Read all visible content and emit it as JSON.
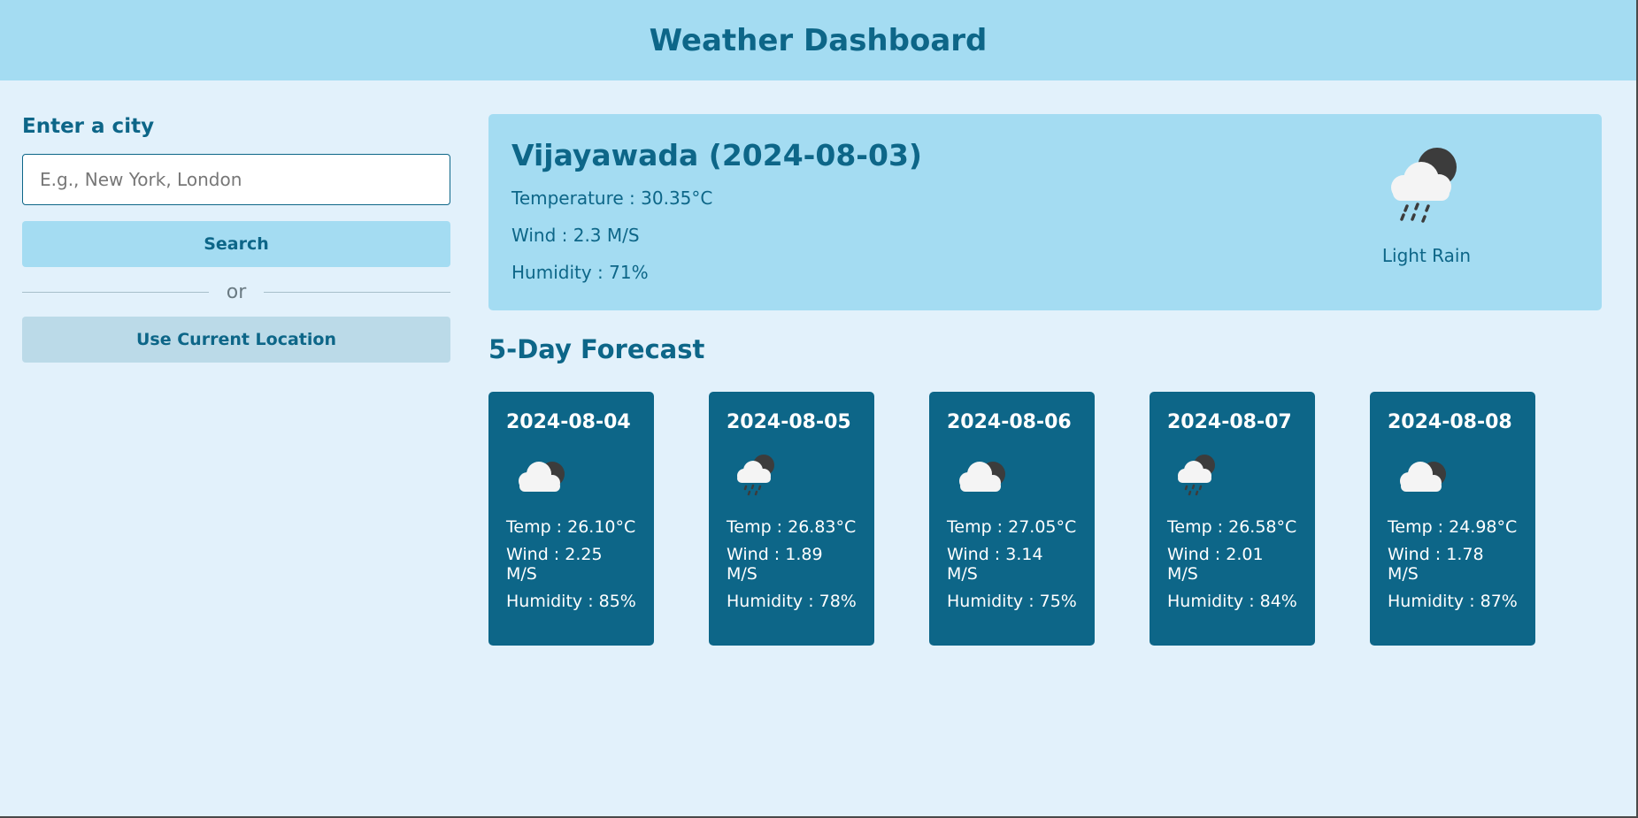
{
  "header": {
    "title": "Weather Dashboard"
  },
  "sidebar": {
    "label": "Enter a city",
    "input_placeholder": "E.g., New York, London",
    "input_value": "",
    "search_label": "Search",
    "or_text": "or",
    "location_label": "Use Current Location"
  },
  "current": {
    "heading": "Vijayawada (2024-08-03)",
    "temperature": "Temperature : 30.35°C",
    "wind": "Wind : 2.3 M/S",
    "humidity": "Humidity : 71%",
    "description": "Light Rain",
    "icon": "cloud-rain-moon-icon"
  },
  "forecast": {
    "title": "5-Day Forecast",
    "days": [
      {
        "date": "2024-08-04",
        "icon": "cloud-moon-icon",
        "temp": "Temp : 26.10°C",
        "wind": "Wind : 2.25 M/S",
        "humidity": "Humidity : 85%"
      },
      {
        "date": "2024-08-05",
        "icon": "cloud-rain-moon-icon",
        "temp": "Temp : 26.83°C",
        "wind": "Wind : 1.89 M/S",
        "humidity": "Humidity : 78%"
      },
      {
        "date": "2024-08-06",
        "icon": "cloud-moon-icon",
        "temp": "Temp : 27.05°C",
        "wind": "Wind : 3.14 M/S",
        "humidity": "Humidity : 75%"
      },
      {
        "date": "2024-08-07",
        "icon": "cloud-rain-moon-icon",
        "temp": "Temp : 26.58°C",
        "wind": "Wind : 2.01 M/S",
        "humidity": "Humidity : 84%"
      },
      {
        "date": "2024-08-08",
        "icon": "cloud-moon-icon",
        "temp": "Temp : 24.98°C",
        "wind": "Wind : 1.78 M/S",
        "humidity": "Humidity : 87%"
      }
    ]
  },
  "colors": {
    "header_bg": "#a4dcf2",
    "page_bg": "#e2f1fb",
    "primary": "#0d6688",
    "card_bg": "#0d6688",
    "secondary_button": "#bbdae8"
  }
}
